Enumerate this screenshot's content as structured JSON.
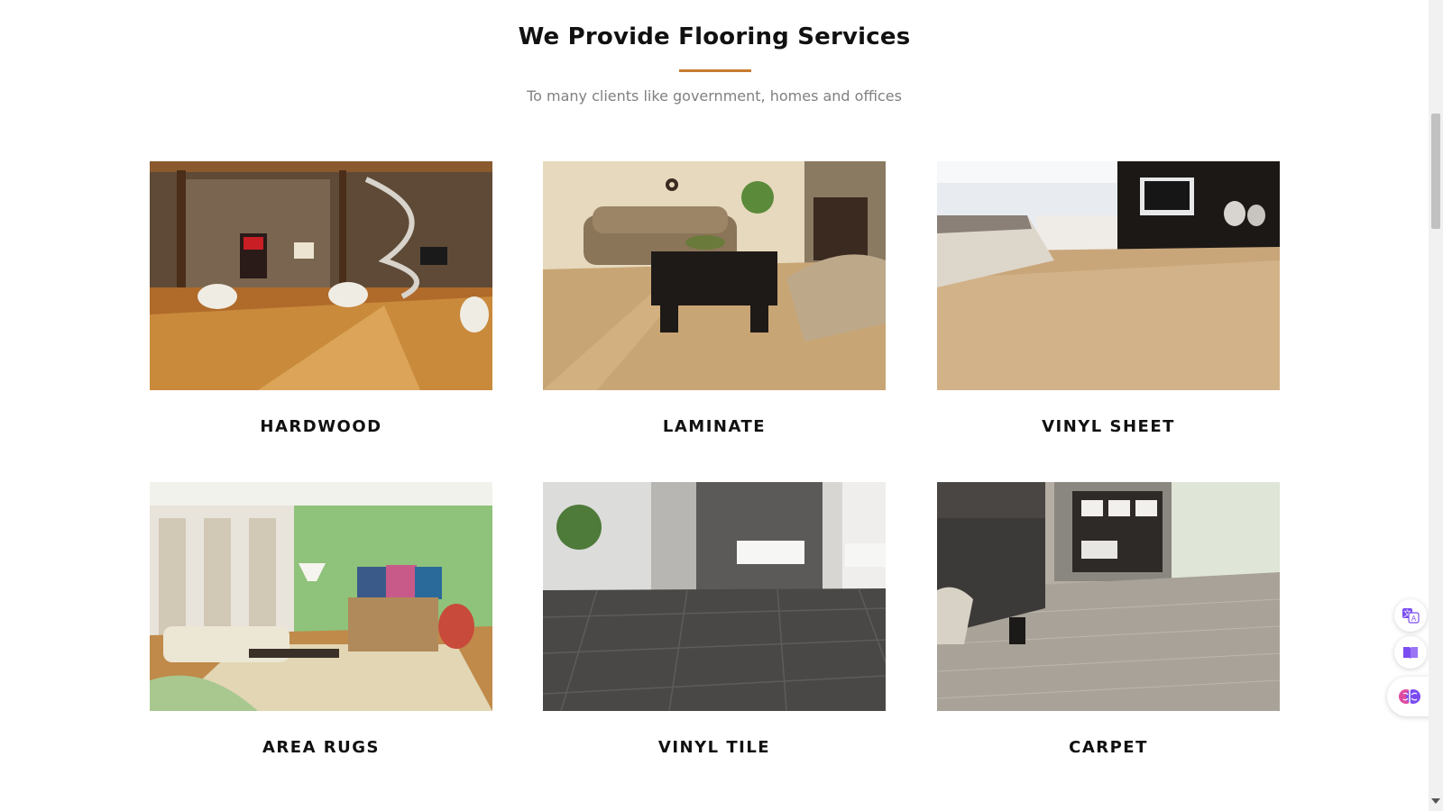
{
  "section": {
    "title": "We Provide Flooring Services",
    "subtitle": "To many clients like government, homes and offices",
    "accent_color": "#c77b30"
  },
  "services": [
    {
      "label": "HARDWOOD"
    },
    {
      "label": "LAMINATE"
    },
    {
      "label": "VINYL SHEET"
    },
    {
      "label": "AREA RUGS"
    },
    {
      "label": "VINYL TILE"
    },
    {
      "label": "CARPET"
    }
  ],
  "floating_buttons": [
    {
      "icon": "translate-icon"
    },
    {
      "icon": "reader-icon"
    },
    {
      "icon": "brain-icon"
    }
  ]
}
